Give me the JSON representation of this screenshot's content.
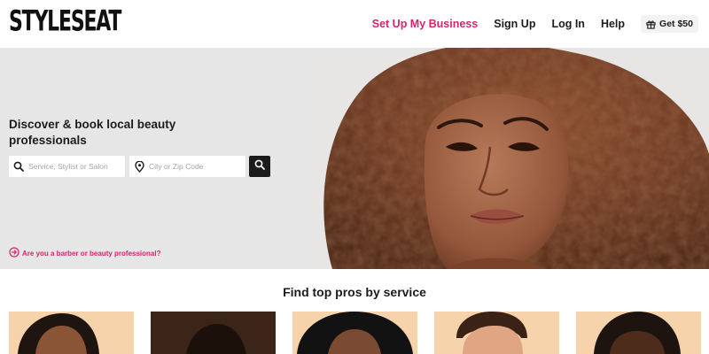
{
  "header": {
    "logo": "STYLESEAT",
    "nav": {
      "setup_business": "Set Up My Business",
      "sign_up": "Sign Up",
      "log_in": "Log In",
      "help": "Help",
      "gift": "Get $50"
    }
  },
  "hero": {
    "title": "Discover & book local beauty professionals",
    "search": {
      "service_placeholder": "Service, Stylist or Salon",
      "location_placeholder": "City or Zip Code"
    },
    "pro_link": "Are you a barber or beauty professional?"
  },
  "services": {
    "title": "Find top pros by service"
  },
  "colors": {
    "accent": "#d6246e",
    "hero_bg": "#e6e6e6",
    "card_bg": "#f6d3ab"
  }
}
